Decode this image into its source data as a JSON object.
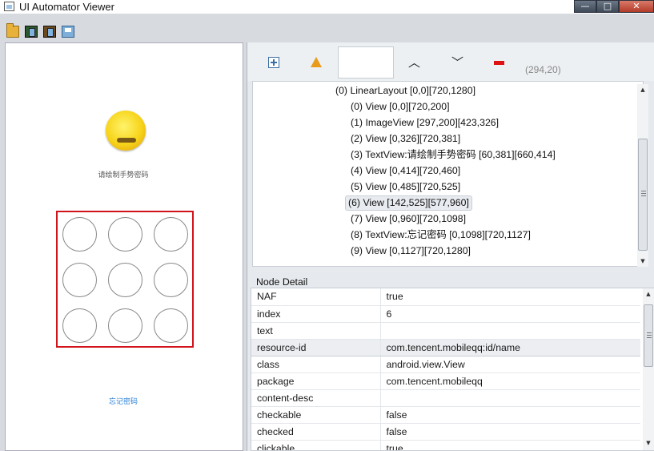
{
  "window": {
    "title": "UI Automator Viewer",
    "controls": {
      "minimize": "—",
      "maximize": "□",
      "close": "✕"
    }
  },
  "toolbar": {
    "icons": [
      "open-folder-icon",
      "device-screenshot-icon",
      "device-screenshot-compressed-icon",
      "save-icon"
    ]
  },
  "device": {
    "prompt": "请绘制手势密码",
    "forgot_password": "忘记密码",
    "gesture_dots": 9,
    "highlight_color": "#d1141c"
  },
  "tree_toolbar": {
    "icons": [
      "expand-all-icon",
      "toggle-naf-warning-icon",
      "previous-node-icon",
      "next-node-icon",
      "collapse-icon"
    ],
    "search_value": "",
    "coordinates": "(294,20)"
  },
  "tree": {
    "nodes": [
      {
        "label": "(0) LinearLayout [0,0][720,1280]",
        "depth": 0,
        "selected": false
      },
      {
        "label": "(0) View [0,0][720,200]",
        "depth": 1,
        "selected": false
      },
      {
        "label": "(1) ImageView [297,200][423,326]",
        "depth": 1,
        "selected": false
      },
      {
        "label": "(2) View [0,326][720,381]",
        "depth": 1,
        "selected": false
      },
      {
        "label": "(3) TextView:请绘制手势密码 [60,381][660,414]",
        "depth": 1,
        "selected": false
      },
      {
        "label": "(4) View [0,414][720,460]",
        "depth": 1,
        "selected": false
      },
      {
        "label": "(5) View [0,485][720,525]",
        "depth": 1,
        "selected": false
      },
      {
        "label": "(6) View [142,525][577,960]",
        "depth": 1,
        "selected": true
      },
      {
        "label": "(7) View [0,960][720,1098]",
        "depth": 1,
        "selected": false
      },
      {
        "label": "(8) TextView:忘记密码 [0,1098][720,1127]",
        "depth": 1,
        "selected": false
      },
      {
        "label": "(9) View [0,1127][720,1280]",
        "depth": 1,
        "selected": false
      }
    ]
  },
  "node_detail": {
    "title": "Node Detail",
    "properties": [
      {
        "key": "NAF",
        "value": "true",
        "selected": false
      },
      {
        "key": "index",
        "value": "6",
        "selected": false
      },
      {
        "key": "text",
        "value": "",
        "selected": false
      },
      {
        "key": "resource-id",
        "value": "com.tencent.mobileqq:id/name",
        "selected": true
      },
      {
        "key": "class",
        "value": "android.view.View",
        "selected": false
      },
      {
        "key": "package",
        "value": "com.tencent.mobileqq",
        "selected": false
      },
      {
        "key": "content-desc",
        "value": "",
        "selected": false
      },
      {
        "key": "checkable",
        "value": "false",
        "selected": false
      },
      {
        "key": "checked",
        "value": "false",
        "selected": false
      },
      {
        "key": "clickable",
        "value": "true",
        "selected": false
      }
    ]
  }
}
